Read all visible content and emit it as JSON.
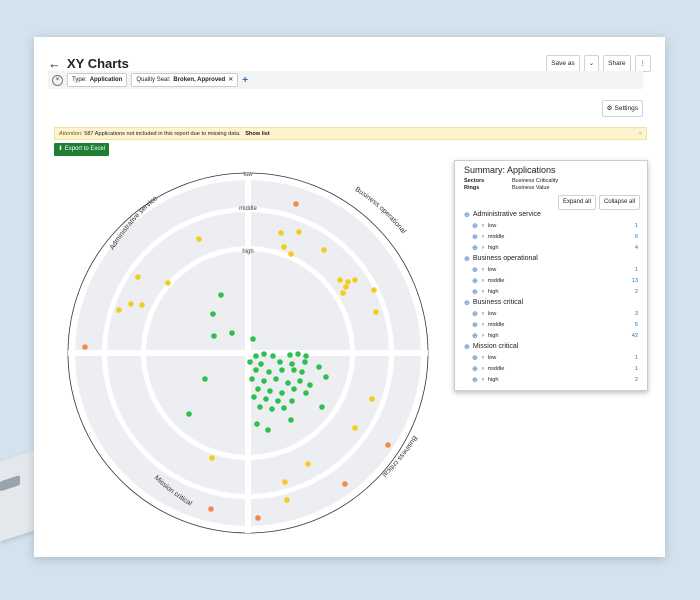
{
  "header": {
    "title": "XY Charts",
    "save_label": "Save as",
    "share_label": "Share",
    "more_label": "⋮",
    "back_label": "←"
  },
  "filters": [
    {
      "key": "Type:",
      "value": "Application"
    },
    {
      "key": "Quality Seal:",
      "value": "Broken, Approved"
    }
  ],
  "settings_label": "Settings",
  "attention": {
    "label": "Attention:",
    "message": "587 Applications not included in this report due to missing data.",
    "action": "Show list"
  },
  "export_label": "Export to Excel",
  "rings": [
    "low",
    "middle",
    "high"
  ],
  "sectors": [
    "Administrative service",
    "Business operational",
    "Business critical",
    "Mission critical"
  ],
  "colors": {
    "green": "#2fbf4e",
    "yellow": "#f4cc1b",
    "orange": "#f28a4c"
  },
  "summary": {
    "title": "Summary: Applications",
    "sectors_key": "Sectors",
    "sectors_value": "Business Criticality",
    "rings_key": "Rings",
    "rings_value": "Business Value",
    "expand_label": "Expand all",
    "collapse_label": "Collapse all",
    "groups": [
      {
        "name": "Administrative service",
        "rows": [
          {
            "label": "low",
            "count": "1"
          },
          {
            "label": "middle",
            "count": "6"
          },
          {
            "label": "high",
            "count": "4"
          }
        ]
      },
      {
        "name": "Business operational",
        "rows": [
          {
            "label": "low",
            "count": "1"
          },
          {
            "label": "middle",
            "count": "13"
          },
          {
            "label": "high",
            "count": "2"
          }
        ]
      },
      {
        "name": "Business critical",
        "rows": [
          {
            "label": "low",
            "count": "3"
          },
          {
            "label": "middle",
            "count": "5"
          },
          {
            "label": "high",
            "count": "42"
          }
        ]
      },
      {
        "name": "Mission critical",
        "rows": [
          {
            "label": "low",
            "count": "1"
          },
          {
            "label": "middle",
            "count": "1"
          },
          {
            "label": "high",
            "count": "2"
          }
        ]
      }
    ]
  }
}
